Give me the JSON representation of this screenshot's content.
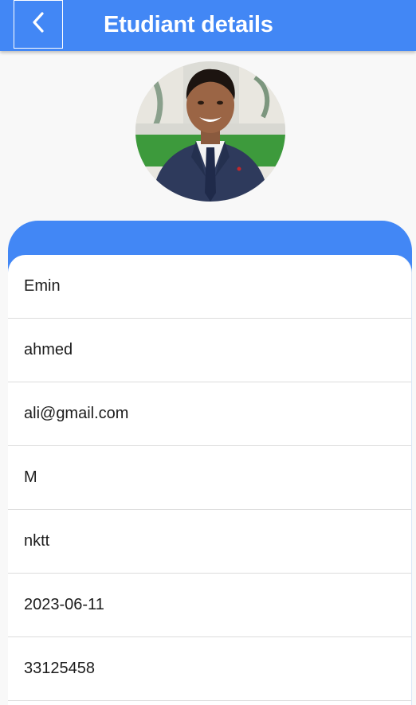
{
  "app_bar": {
    "title": "Etudiant details",
    "back_icon": "chevron-left-icon",
    "color": "#4287f5"
  },
  "profile": {
    "avatar": "student-photo"
  },
  "details": [
    {
      "value": "Emin"
    },
    {
      "value": "ahmed"
    },
    {
      "value": "ali@gmail.com"
    },
    {
      "value": "M"
    },
    {
      "value": "nktt"
    },
    {
      "value": "2023-06-11"
    },
    {
      "value": "33125458"
    }
  ]
}
